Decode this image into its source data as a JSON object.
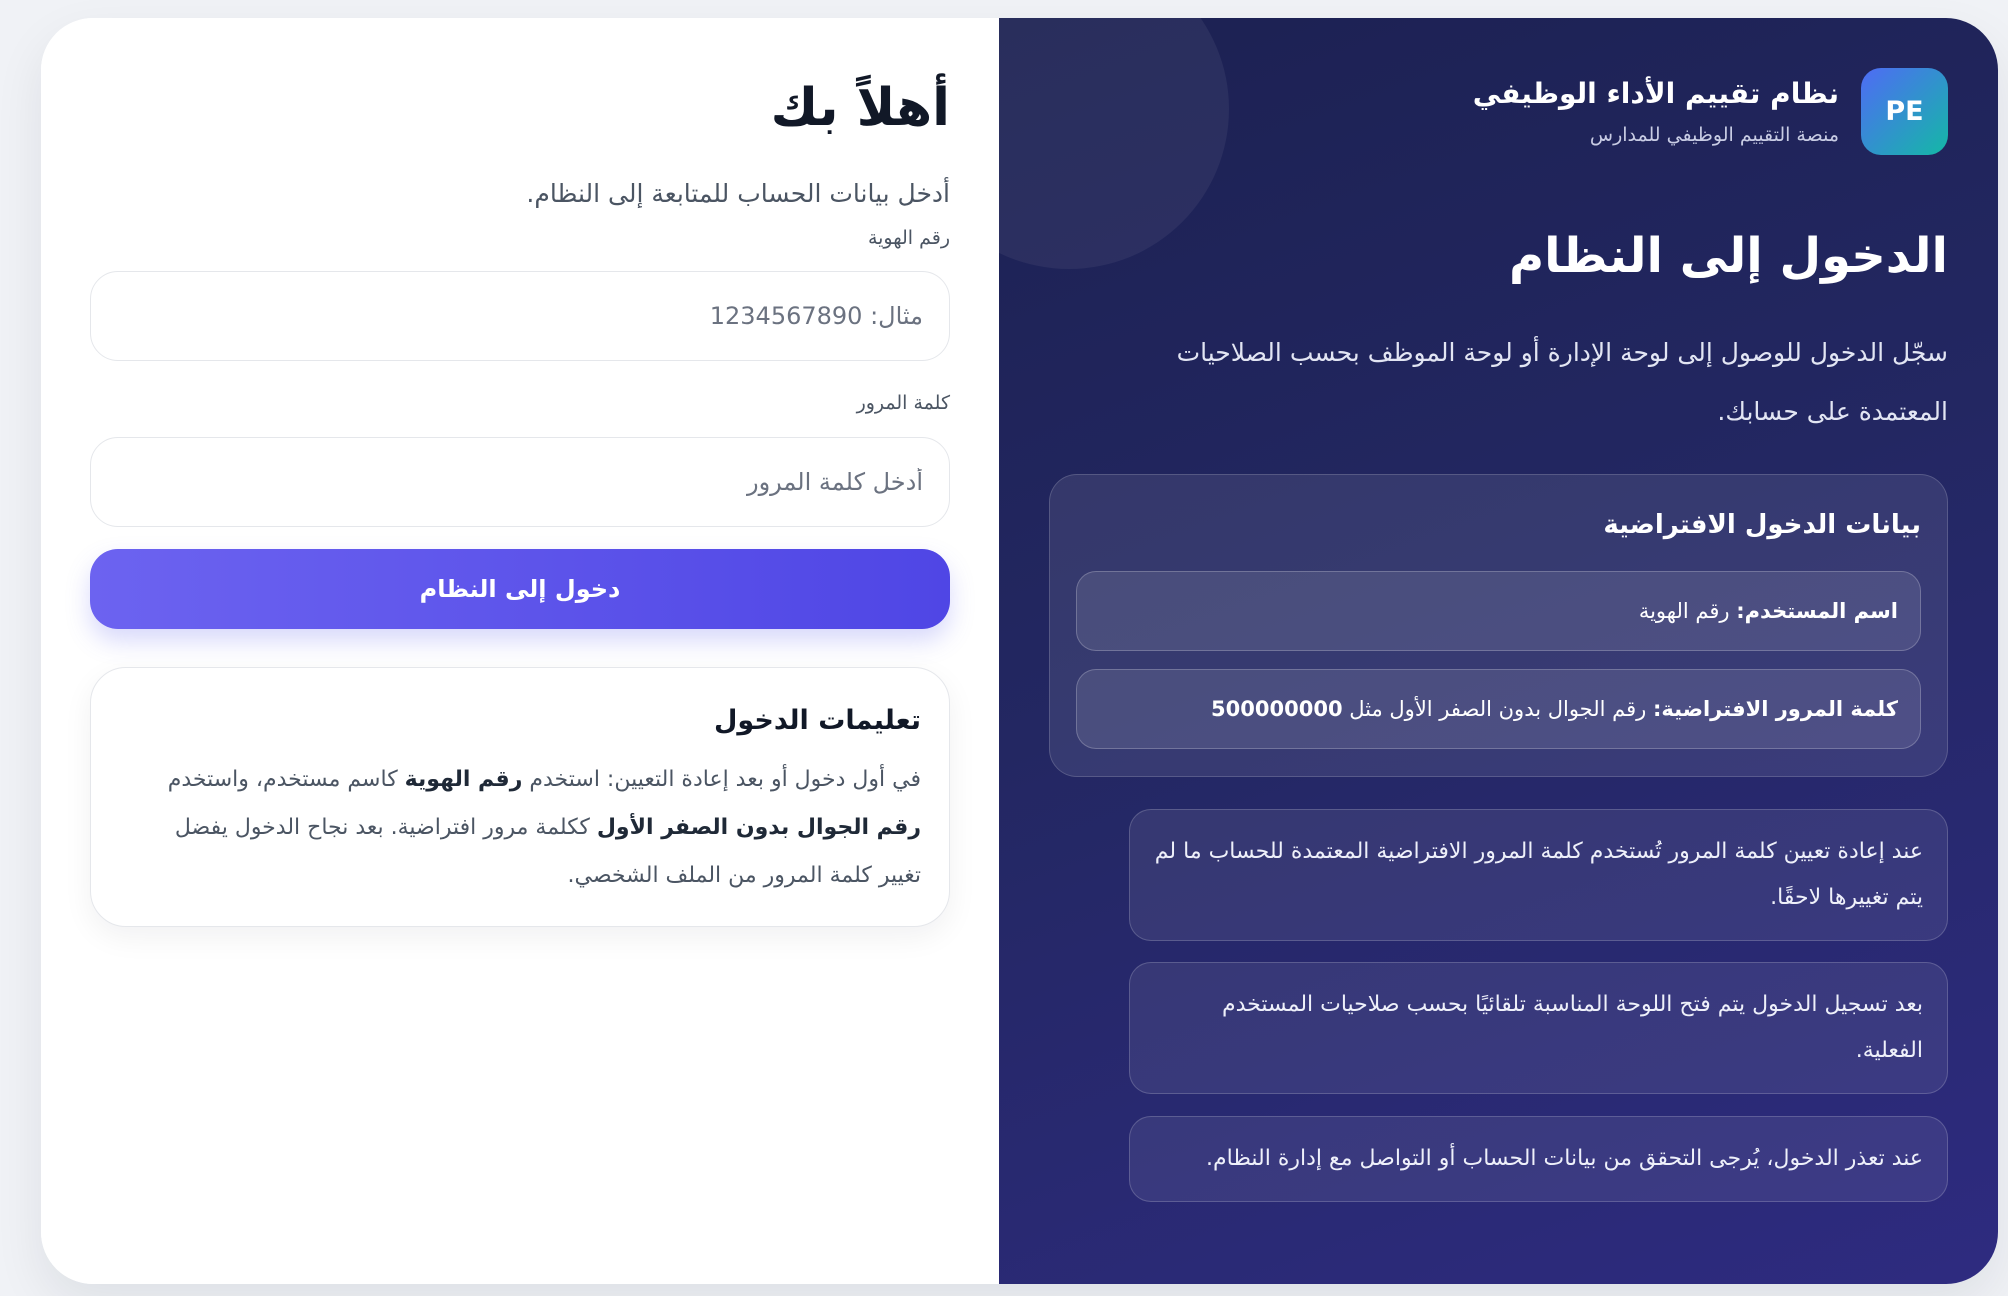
{
  "theme": {
    "page_bg": "#f0f2f6",
    "accent": "#4f46e5",
    "panel_gradient_start": "#1c2152",
    "panel_gradient_end": "#2e2b80",
    "logo_start": "#4f6bf5",
    "logo_end": "#14b8a6"
  },
  "brand": {
    "logo_text": "PE",
    "title": "نظام تقييم الأداء الوظيفي",
    "subtitle": "منصة التقييم الوظيفي للمدارس"
  },
  "hero": {
    "heading": "الدخول إلى النظام",
    "description": "سجّل الدخول للوصول إلى لوحة الإدارة أو لوحة الموظف بحسب الصلاحيات المعتمدة على حسابك."
  },
  "default_credentials": {
    "title": "بيانات الدخول الافتراضية",
    "username": {
      "label": "اسم المستخدم:",
      "value": "رقم الهوية"
    },
    "password": {
      "label": "كلمة المرور الافتراضية:",
      "value": "رقم الجوال بدون الصفر الأول مثل",
      "example": "500000000"
    }
  },
  "notes": [
    "عند إعادة تعيين كلمة المرور تُستخدم كلمة المرور الافتراضية المعتمدة للحساب ما لم يتم تغييرها لاحقًا.",
    "بعد تسجيل الدخول يتم فتح اللوحة المناسبة تلقائيًا بحسب صلاحيات المستخدم الفعلية.",
    "عند تعذر الدخول، يُرجى التحقق من بيانات الحساب أو التواصل مع إدارة النظام."
  ],
  "login": {
    "greeting": "أهلاً بك",
    "intro": "أدخل بيانات الحساب للمتابعة إلى النظام.",
    "id_label": "رقم الهوية",
    "id_value": "",
    "id_placeholder": "مثال: 1234567890",
    "password_label": "كلمة المرور",
    "password_value": "",
    "password_placeholder": "أدخل كلمة المرور",
    "submit_label": "دخول إلى النظام"
  },
  "instructions": {
    "title": "تعليمات الدخول",
    "text_1": "في أول دخول أو بعد إعادة التعيين: استخدم",
    "bold_1": "رقم الهوية",
    "text_2": "كاسم مستخدم، واستخدم",
    "bold_2": "رقم الجوال بدون الصفر الأول",
    "text_3": "ككلمة مرور افتراضية. بعد نجاح الدخول يفضل تغيير كلمة المرور من الملف الشخصي."
  }
}
